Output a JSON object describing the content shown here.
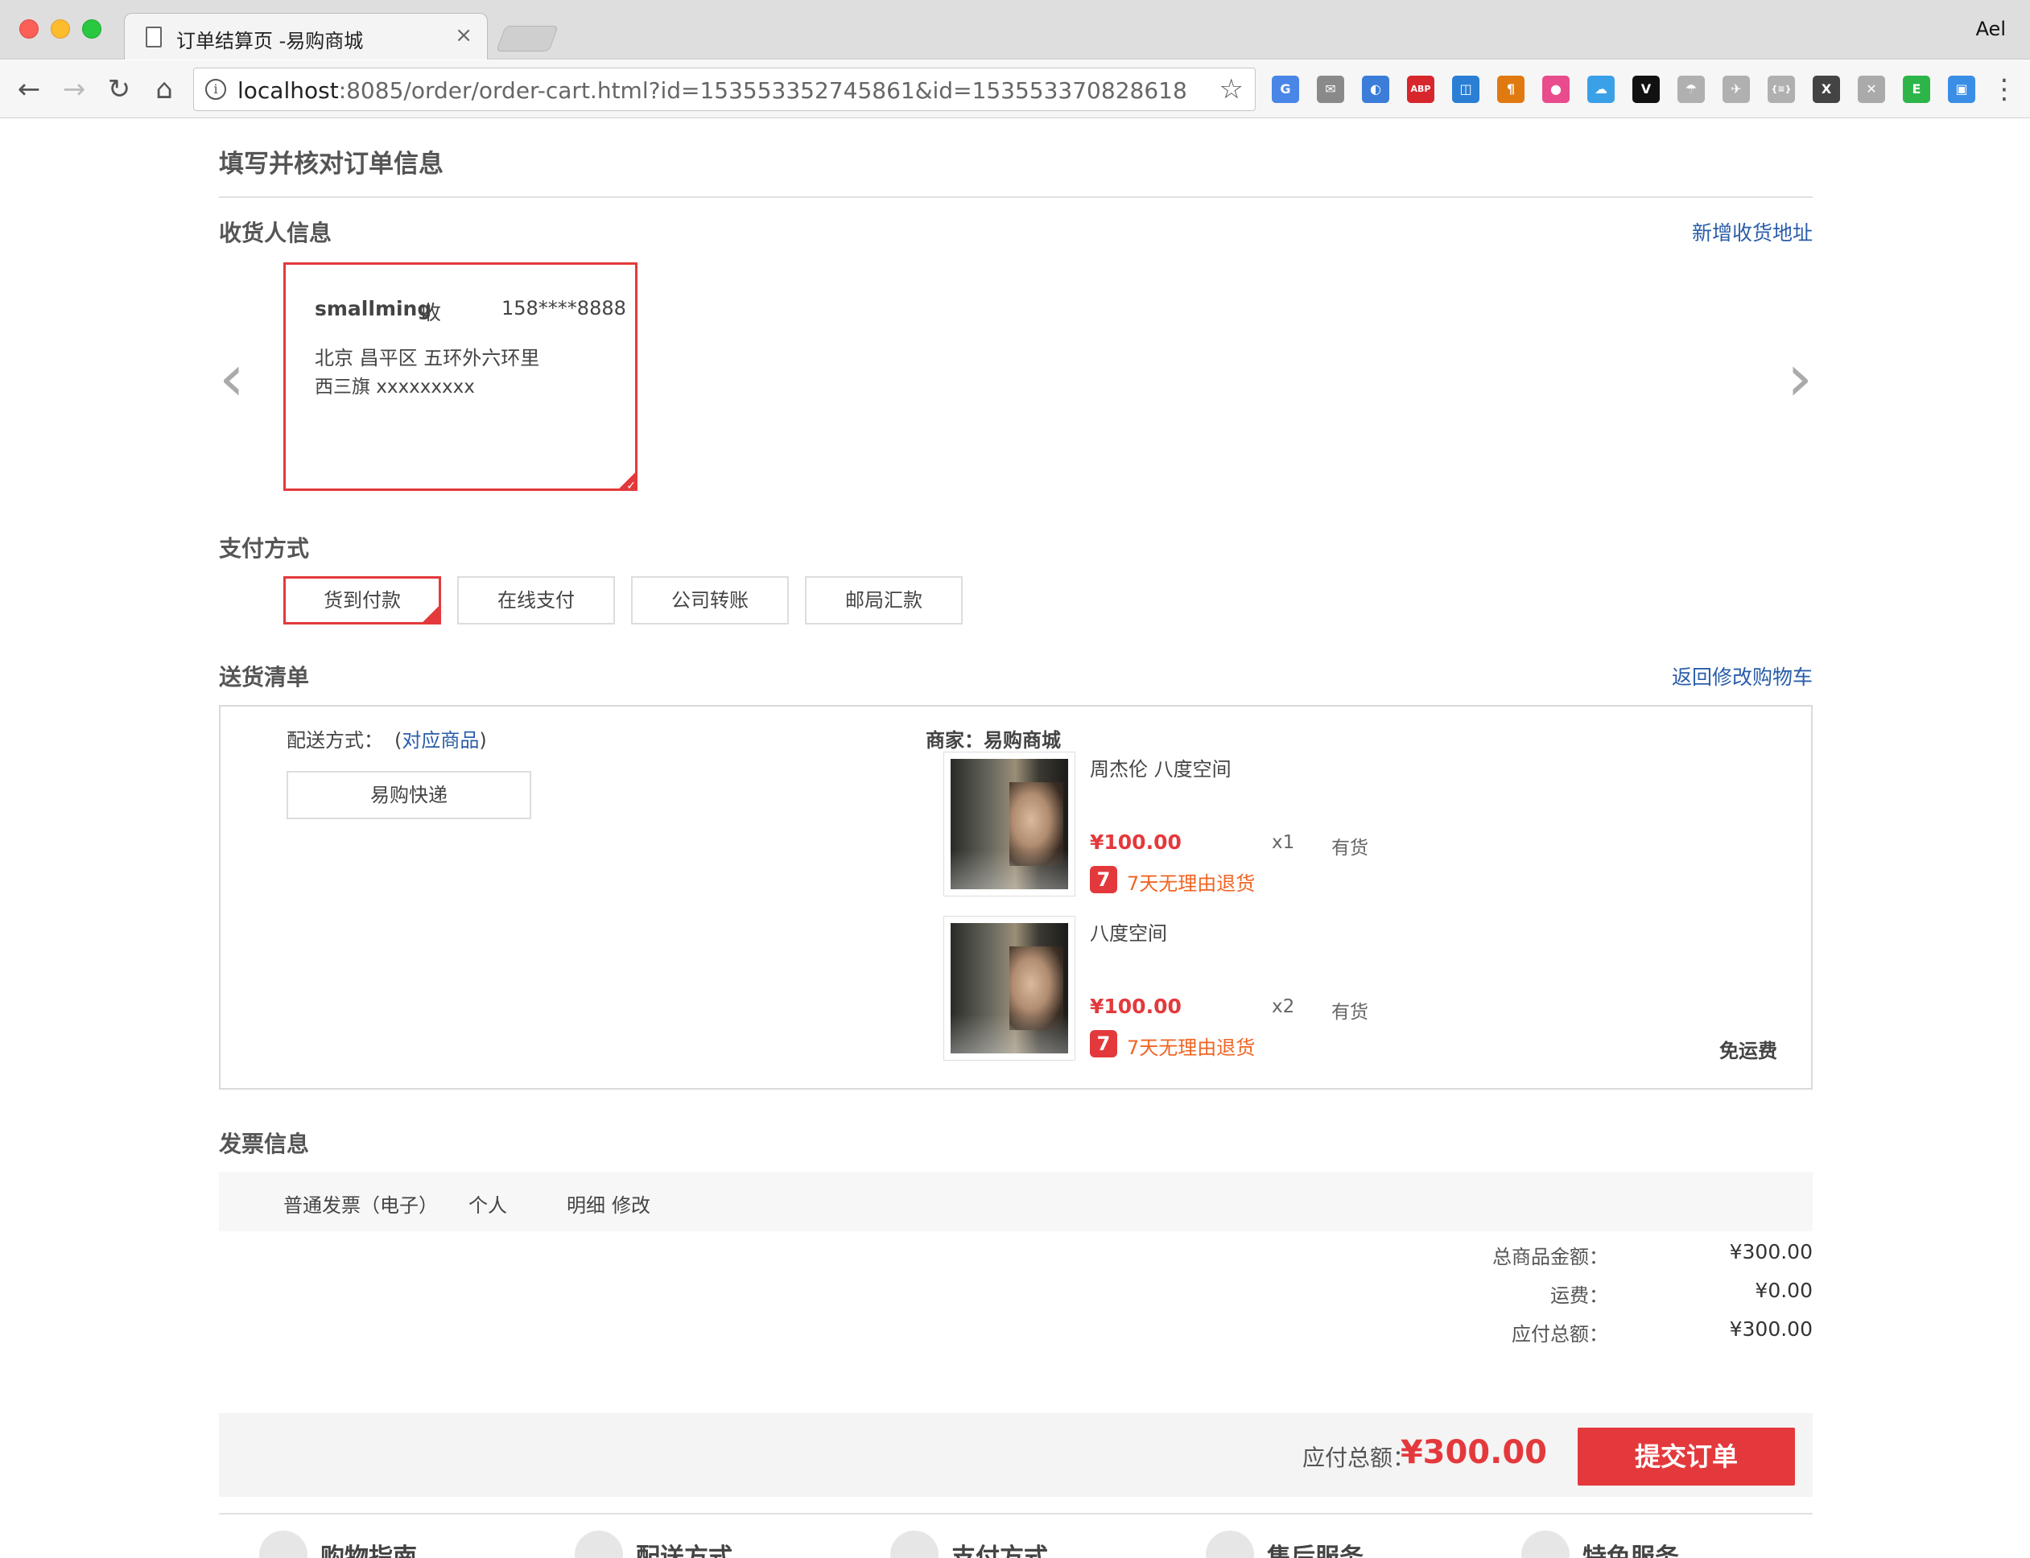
{
  "browser": {
    "tab_title": "订单结算页 -易购商城",
    "tab_close": "×",
    "profile": "Ael",
    "url_host": "localhost",
    "url_rest": ":8085/order/order-cart.html?id=153553352745861&id=153553370828618",
    "nav": {
      "back": "←",
      "forward": "→",
      "reload": "↻",
      "home": "⌂"
    },
    "star": "☆",
    "extensions": [
      {
        "name": "google-translate-icon",
        "color": "#4a86e8",
        "label": "G"
      },
      {
        "name": "gmail-checker-icon",
        "color": "#8a8a8a",
        "label": "✉"
      },
      {
        "name": "screenshot-ext-icon",
        "color": "#3b7dd8",
        "label": "◐"
      },
      {
        "name": "adblock-plus-icon",
        "color": "#d8262d",
        "label": "ABP"
      },
      {
        "name": "web-dev-ext-icon",
        "color": "#2a7fd4",
        "label": "◫"
      },
      {
        "name": "formatting-ext-icon",
        "color": "#e07a10",
        "label": "¶"
      },
      {
        "name": "color-picker-icon",
        "color": "#e84c8c",
        "label": "●"
      },
      {
        "name": "cloud-ext-icon",
        "color": "#3aa0e8",
        "label": "☁"
      },
      {
        "name": "vue-devtools-icon",
        "color": "#111111",
        "label": "V"
      },
      {
        "name": "parachute-ext-icon",
        "color": "#b0b0b0",
        "label": "☂"
      },
      {
        "name": "plane-ext-icon",
        "color": "#b0b0b0",
        "label": "✈"
      },
      {
        "name": "json-viewer-icon",
        "color": "#b0b0b0",
        "label": "{≡}"
      },
      {
        "name": "x-square-ext-icon",
        "color": "#444444",
        "label": "X"
      },
      {
        "name": "x-ext-icon",
        "color": "#aaaaaa",
        "label": "✕"
      },
      {
        "name": "evernote-icon",
        "color": "#2db54a",
        "label": "E"
      },
      {
        "name": "save-ext-icon",
        "color": "#3a8ee6",
        "label": "▣"
      }
    ],
    "menu": "⋮"
  },
  "page": {
    "title": "填写并核对订单信息",
    "consignee": {
      "section_title": "收货人信息",
      "add_address": "新增收货地址",
      "prev": "‹",
      "next": "›",
      "card": {
        "name": "smallming",
        "receive": "收",
        "phone": "158****8888",
        "line1": "北京 昌平区 五环外六环里",
        "line2": "西三旗 xxxxxxxxx"
      }
    },
    "payment": {
      "section_title": "支付方式",
      "options": [
        "货到付款",
        "在线支付",
        "公司转账",
        "邮局汇款"
      ],
      "selected": "货到付款"
    },
    "shipping": {
      "section_title": "送货清单",
      "back_to_cart": "返回修改购物车",
      "method_label": "配送方式：",
      "method_paren_open": "(",
      "method_link": "对应商品",
      "method_paren_close": ")",
      "express": "易购快递",
      "merchant": "商家：易购商城",
      "free_shipping": "免运费",
      "items": [
        {
          "name": "周杰伦 八度空间",
          "price": "¥100.00",
          "qty": "x1",
          "stock": "有货",
          "return_badge": "7",
          "return_text": "7天无理由退货"
        },
        {
          "name": "八度空间",
          "price": "¥100.00",
          "qty": "x2",
          "stock": "有货",
          "return_badge": "7",
          "return_text": "7天无理由退货"
        }
      ]
    },
    "invoice": {
      "section_title": "发票信息",
      "type": "普通发票（电子）",
      "holder": "个人",
      "detail": "明细",
      "edit": "修改"
    },
    "summary": {
      "goods_label": "总商品金额：",
      "goods_value": "¥300.00",
      "freight_label": "运费：",
      "freight_value": "¥0.00",
      "total_label": "应付总额：",
      "total_value": "¥300.00"
    },
    "submit": {
      "label": "应付总额：",
      "amount": "¥300.00",
      "button": "提交订单"
    },
    "footer": [
      "购物指南",
      "配送方式",
      "支付方式",
      "售后服务",
      "特色服务"
    ]
  }
}
